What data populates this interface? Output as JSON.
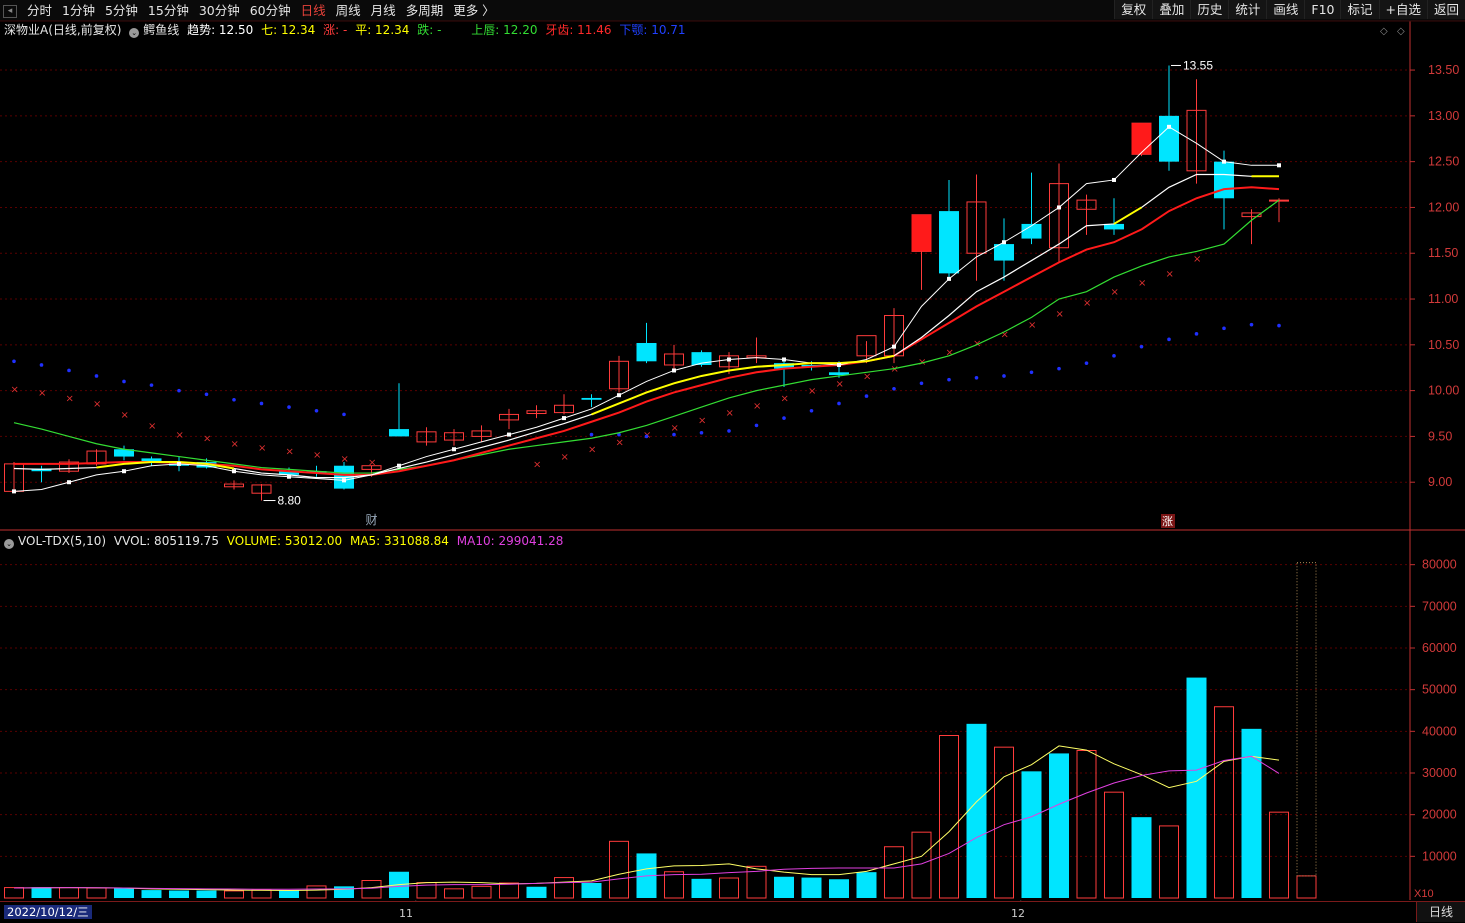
{
  "toolbar": {
    "tabs": [
      "分时",
      "1分钟",
      "5分钟",
      "15分钟",
      "30分钟",
      "60分钟",
      "日线",
      "周线",
      "月线",
      "多周期",
      "更多 〉"
    ],
    "active_tab": "日线",
    "tools": [
      "复权",
      "叠加",
      "历史",
      "统计",
      "画线",
      "F10",
      "标记",
      "+自选",
      "返回"
    ]
  },
  "info": {
    "stock": "深物业A(日线,前复权)",
    "indicator": "鳄鱼线",
    "trend": "趋势: 12.50",
    "seven": "七: 12.34",
    "rise": "涨: -",
    "flat": "平: 12.34",
    "fall": "跌: -",
    "upper": "上唇: 12.20",
    "teeth": "牙齿: 11.46",
    "lower": "下颚: 10.71"
  },
  "vol_info": {
    "name": "VOL-TDX(5,10)",
    "vvol": "VVOL: 805119.75",
    "volume": "VOLUME: 53012.00",
    "ma5": "MA5: 331088.84",
    "ma10": "MA10: 299041.28"
  },
  "bottom": {
    "date": "2022/10/12/三",
    "month_11": "11",
    "month_12": "12",
    "period": "日线"
  },
  "annotations": {
    "high": "13.55",
    "low": "8.80",
    "cai": "财",
    "zhang": "涨",
    "x10": "X10"
  },
  "colors": {
    "up": "#ff3b3b",
    "down": "#00e5ff",
    "grid": "#5a0000",
    "axis": "#c03030",
    "ma_white": "#ffffff",
    "lips_yellow": "#ffff00",
    "teeth_red": "#ff1a1a",
    "jaw_green": "#33dd33",
    "ma5_vol": "#ffff66",
    "ma10_vol": "#e040e0"
  },
  "chart_data": {
    "type": "candlestick",
    "price_axis": {
      "ticks": [
        9.0,
        9.5,
        10.0,
        10.5,
        11.0,
        11.5,
        12.0,
        12.5,
        13.0,
        13.5
      ],
      "range": [
        8.5,
        13.85
      ]
    },
    "volume_axis": {
      "ticks": [
        10000,
        20000,
        30000,
        40000,
        50000,
        60000,
        70000,
        80000
      ],
      "range": [
        0,
        84000
      ],
      "multiplier": "X10"
    },
    "candles": [
      {
        "o": 9.2,
        "h": 9.22,
        "l": 8.88,
        "c": 8.9,
        "up": true
      },
      {
        "o": 9.15,
        "h": 9.18,
        "l": 9.0,
        "c": 9.12,
        "up": false
      },
      {
        "o": 9.12,
        "h": 9.25,
        "l": 9.1,
        "c": 9.22,
        "up": true
      },
      {
        "o": 9.2,
        "h": 9.36,
        "l": 9.18,
        "c": 9.34,
        "up": true
      },
      {
        "o": 9.36,
        "h": 9.4,
        "l": 9.24,
        "c": 9.28,
        "up": false
      },
      {
        "o": 9.26,
        "h": 9.28,
        "l": 9.18,
        "c": 9.22,
        "up": false
      },
      {
        "o": 9.22,
        "h": 9.28,
        "l": 9.12,
        "c": 9.18,
        "up": false
      },
      {
        "o": 9.22,
        "h": 9.26,
        "l": 9.15,
        "c": 9.16,
        "up": false
      },
      {
        "o": 8.98,
        "h": 9.02,
        "l": 8.92,
        "c": 8.95,
        "up": true
      },
      {
        "o": 8.88,
        "h": 8.98,
        "l": 8.8,
        "c": 8.97,
        "up": true
      },
      {
        "o": 9.12,
        "h": 9.16,
        "l": 9.05,
        "c": 9.08,
        "up": false
      },
      {
        "o": 9.12,
        "h": 9.18,
        "l": 9.06,
        "c": 9.1,
        "up": false
      },
      {
        "o": 9.18,
        "h": 9.22,
        "l": 8.92,
        "c": 8.93,
        "up": false
      },
      {
        "o": 9.14,
        "h": 9.18,
        "l": 9.06,
        "c": 9.18,
        "up": true
      },
      {
        "o": 9.58,
        "h": 10.08,
        "l": 9.5,
        "c": 9.5,
        "up": false
      },
      {
        "o": 9.44,
        "h": 9.6,
        "l": 9.4,
        "c": 9.55,
        "up": true
      },
      {
        "o": 9.46,
        "h": 9.58,
        "l": 9.4,
        "c": 9.54,
        "up": true
      },
      {
        "o": 9.5,
        "h": 9.62,
        "l": 9.44,
        "c": 9.56,
        "up": true
      },
      {
        "o": 9.68,
        "h": 9.8,
        "l": 9.58,
        "c": 9.74,
        "up": true
      },
      {
        "o": 9.78,
        "h": 9.84,
        "l": 9.7,
        "c": 9.75,
        "up": true
      },
      {
        "o": 9.76,
        "h": 9.96,
        "l": 9.74,
        "c": 9.84,
        "up": true
      },
      {
        "o": 9.9,
        "h": 9.96,
        "l": 9.82,
        "c": 9.92,
        "up": false
      },
      {
        "o": 10.02,
        "h": 10.38,
        "l": 9.98,
        "c": 10.32,
        "up": true
      },
      {
        "o": 10.52,
        "h": 10.74,
        "l": 10.3,
        "c": 10.32,
        "up": false
      },
      {
        "o": 10.28,
        "h": 10.5,
        "l": 10.24,
        "c": 10.4,
        "up": true
      },
      {
        "o": 10.42,
        "h": 10.44,
        "l": 10.26,
        "c": 10.28,
        "up": false
      },
      {
        "o": 10.26,
        "h": 10.42,
        "l": 10.18,
        "c": 10.38,
        "up": true
      },
      {
        "o": 10.36,
        "h": 10.58,
        "l": 10.3,
        "c": 10.38,
        "up": true
      },
      {
        "o": 10.3,
        "h": 10.36,
        "l": 10.04,
        "c": 10.24,
        "up": false
      },
      {
        "o": 10.28,
        "h": 10.32,
        "l": 10.22,
        "c": 10.26,
        "up": false
      },
      {
        "o": 10.2,
        "h": 10.32,
        "l": 10.14,
        "c": 10.17,
        "up": false
      },
      {
        "o": 10.38,
        "h": 10.54,
        "l": 10.3,
        "c": 10.6,
        "up": true
      },
      {
        "o": 10.38,
        "h": 10.9,
        "l": 10.3,
        "c": 10.82,
        "up": true
      },
      {
        "o": 11.52,
        "h": 11.92,
        "l": 11.1,
        "c": 11.92,
        "up": true
      },
      {
        "o": 11.96,
        "h": 12.3,
        "l": 11.22,
        "c": 11.28,
        "up": false
      },
      {
        "o": 11.5,
        "h": 12.36,
        "l": 11.2,
        "c": 12.06,
        "up": true
      },
      {
        "o": 11.6,
        "h": 11.88,
        "l": 11.2,
        "c": 11.42,
        "up": false
      },
      {
        "o": 11.82,
        "h": 12.38,
        "l": 11.6,
        "c": 11.66,
        "up": false
      },
      {
        "o": 11.56,
        "h": 12.48,
        "l": 11.4,
        "c": 12.26,
        "up": true
      },
      {
        "o": 11.98,
        "h": 12.14,
        "l": 11.7,
        "c": 12.08,
        "up": true
      },
      {
        "o": 11.82,
        "h": 12.1,
        "l": 11.7,
        "c": 11.76,
        "up": false
      },
      {
        "o": 12.58,
        "h": 12.92,
        "l": 12.56,
        "c": 12.92,
        "up": true
      },
      {
        "o": 13.0,
        "h": 13.55,
        "l": 12.4,
        "c": 12.5,
        "up": false
      },
      {
        "o": 12.4,
        "h": 13.4,
        "l": 12.26,
        "c": 13.06,
        "up": true
      },
      {
        "o": 12.5,
        "h": 12.62,
        "l": 11.76,
        "c": 12.1,
        "up": false
      },
      {
        "o": 11.9,
        "h": 11.98,
        "l": 11.6,
        "c": 11.94,
        "up": true
      },
      {
        "o": 12.08,
        "h": 12.1,
        "l": 11.84,
        "c": 12.08,
        "up": true
      }
    ],
    "volumes": [
      {
        "v": 2500,
        "up": true
      },
      {
        "v": 2600,
        "up": false
      },
      {
        "v": 2500,
        "up": true
      },
      {
        "v": 2400,
        "up": true
      },
      {
        "v": 2300,
        "up": false
      },
      {
        "v": 1900,
        "up": false
      },
      {
        "v": 1800,
        "up": false
      },
      {
        "v": 1800,
        "up": false
      },
      {
        "v": 1700,
        "up": true
      },
      {
        "v": 1900,
        "up": true
      },
      {
        "v": 1800,
        "up": false
      },
      {
        "v": 2900,
        "up": true
      },
      {
        "v": 2800,
        "up": false
      },
      {
        "v": 4200,
        "up": true
      },
      {
        "v": 6300,
        "up": false
      },
      {
        "v": 3700,
        "up": true
      },
      {
        "v": 2200,
        "up": true
      },
      {
        "v": 2800,
        "up": true
      },
      {
        "v": 3600,
        "up": true
      },
      {
        "v": 2700,
        "up": false
      },
      {
        "v": 4900,
        "up": true
      },
      {
        "v": 3600,
        "up": false
      },
      {
        "v": 13600,
        "up": true
      },
      {
        "v": 10700,
        "up": false
      },
      {
        "v": 6300,
        "up": true
      },
      {
        "v": 4600,
        "up": false
      },
      {
        "v": 4800,
        "up": true
      },
      {
        "v": 7600,
        "up": true
      },
      {
        "v": 5100,
        "up": false
      },
      {
        "v": 4900,
        "up": false
      },
      {
        "v": 4500,
        "up": false
      },
      {
        "v": 6200,
        "up": false
      },
      {
        "v": 12300,
        "up": true
      },
      {
        "v": 15800,
        "up": true
      },
      {
        "v": 39000,
        "up": true
      },
      {
        "v": 41800,
        "up": false
      },
      {
        "v": 36200,
        "up": true
      },
      {
        "v": 30400,
        "up": false
      },
      {
        "v": 34700,
        "up": false
      },
      {
        "v": 35400,
        "up": true
      },
      {
        "v": 25400,
        "up": true
      },
      {
        "v": 19400,
        "up": false
      },
      {
        "v": 17300,
        "up": true
      },
      {
        "v": 52900,
        "up": false
      },
      {
        "v": 45900,
        "up": true
      },
      {
        "v": 40600,
        "up": false
      },
      {
        "v": 20600,
        "up": true
      },
      {
        "v": 5300,
        "up": true
      }
    ],
    "ma_white": [
      8.9,
      8.92,
      9.0,
      9.08,
      9.12,
      9.18,
      9.2,
      9.18,
      9.12,
      9.08,
      9.06,
      9.04,
      9.02,
      9.08,
      9.18,
      9.28,
      9.36,
      9.44,
      9.52,
      9.6,
      9.7,
      9.8,
      9.95,
      10.1,
      10.22,
      10.3,
      10.34,
      10.36,
      10.34,
      10.3,
      10.28,
      10.34,
      10.48,
      10.92,
      11.22,
      11.46,
      11.62,
      11.8,
      12.0,
      12.26,
      12.3,
      12.6,
      12.88,
      12.7,
      12.5,
      12.46,
      12.46
    ],
    "lips": [
      9.15,
      9.14,
      9.15,
      9.16,
      9.2,
      9.22,
      9.22,
      9.2,
      9.15,
      9.1,
      9.08,
      9.05,
      9.05,
      9.08,
      9.15,
      9.22,
      9.3,
      9.38,
      9.46,
      9.55,
      9.64,
      9.74,
      9.86,
      9.98,
      10.08,
      10.16,
      10.22,
      10.26,
      10.28,
      10.3,
      10.3,
      10.32,
      10.38,
      10.58,
      10.82,
      11.08,
      11.24,
      11.42,
      11.6,
      11.8,
      11.82,
      12.0,
      12.22,
      12.36,
      12.36,
      12.34,
      12.34
    ],
    "teeth": [
      9.2,
      9.2,
      9.2,
      9.21,
      9.22,
      9.22,
      9.21,
      9.2,
      9.18,
      9.14,
      9.12,
      9.1,
      9.08,
      9.08,
      9.12,
      9.18,
      9.24,
      9.32,
      9.4,
      9.48,
      9.56,
      9.66,
      9.76,
      9.88,
      9.98,
      10.06,
      10.14,
      10.2,
      10.24,
      10.26,
      10.28,
      10.32,
      10.38,
      10.56,
      10.74,
      10.92,
      11.08,
      11.24,
      11.4,
      11.54,
      11.62,
      11.76,
      11.96,
      12.1,
      12.2,
      12.22,
      12.2
    ],
    "jaw": [
      9.65,
      9.58,
      9.5,
      9.42,
      9.36,
      9.32,
      9.28,
      9.24,
      9.2,
      9.16,
      9.14,
      9.12,
      9.1,
      9.1,
      9.14,
      9.18,
      9.24,
      9.3,
      9.36,
      9.4,
      9.44,
      9.48,
      9.54,
      9.62,
      9.72,
      9.82,
      9.92,
      10.0,
      10.06,
      10.12,
      10.16,
      10.2,
      10.24,
      10.3,
      10.38,
      10.5,
      10.64,
      10.8,
      11.0,
      11.08,
      11.24,
      11.36,
      11.46,
      11.52,
      11.6,
      11.86,
      12.08
    ],
    "sar_red": [
      10.02,
      9.98,
      9.92,
      9.86,
      9.74,
      9.62,
      9.52,
      9.48,
      9.42,
      9.38,
      9.34,
      9.3,
      9.26,
      9.22,
      null,
      null,
      null,
      null,
      null,
      9.2,
      9.28,
      9.36,
      9.44,
      9.52,
      9.6,
      9.68,
      9.76,
      9.84,
      9.92,
      10.0,
      10.08,
      10.16,
      10.24,
      10.32,
      10.42,
      10.52,
      10.62,
      10.72,
      10.84,
      10.96,
      11.08,
      11.18,
      11.28,
      11.44,
      null,
      null,
      null
    ],
    "sar_blue": [
      10.32,
      10.28,
      10.22,
      10.16,
      10.1,
      10.06,
      10.0,
      9.96,
      9.9,
      9.86,
      9.82,
      9.78,
      9.74,
      null,
      null,
      null,
      null,
      null,
      null,
      null,
      null,
      9.52,
      9.52,
      9.5,
      9.52,
      9.54,
      9.56,
      9.62,
      9.7,
      9.78,
      9.86,
      9.94,
      10.02,
      10.08,
      10.12,
      10.14,
      10.16,
      10.2,
      10.24,
      10.3,
      10.38,
      10.48,
      10.56,
      10.62,
      10.68,
      10.72,
      10.71
    ],
    "vol_ma5": [
      2400,
      2450,
      2500,
      2450,
      2400,
      2200,
      2100,
      2000,
      1900,
      1850,
      1800,
      1900,
      2100,
      2500,
      3200,
      3700,
      3800,
      3700,
      3400,
      3500,
      3800,
      4100,
      5700,
      7000,
      7700,
      7800,
      8200,
      7000,
      6200,
      5600,
      5600,
      6400,
      8200,
      10000,
      15900,
      23100,
      29100,
      32000,
      36500,
      35500,
      32200,
      29600,
      26500,
      28000,
      32800,
      34000,
      33100
    ],
    "vol_ma10": [
      2400,
      2450,
      2480,
      2450,
      2400,
      2300,
      2250,
      2200,
      2150,
      2100,
      2100,
      2150,
      2200,
      2350,
      2800,
      3100,
      3200,
      3200,
      3300,
      3500,
      3700,
      3800,
      4600,
      5300,
      5600,
      5700,
      6100,
      6400,
      6900,
      7100,
      7200,
      7200,
      7200,
      8200,
      10700,
      14500,
      17600,
      19500,
      22500,
      25200,
      27600,
      29400,
      30500,
      30700,
      33000,
      34000,
      29900
    ]
  }
}
